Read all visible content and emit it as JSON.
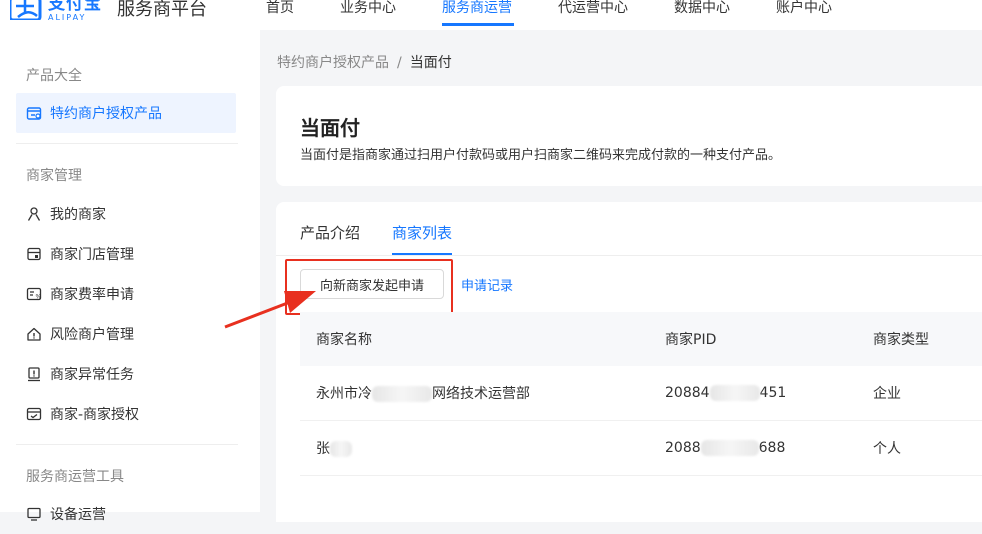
{
  "header": {
    "logo_cn": "支付宝",
    "logo_en": "ALIPAY",
    "platform": "服务商平台",
    "nav": [
      {
        "label": "首页"
      },
      {
        "label": "业务中心"
      },
      {
        "label": "服务商运营"
      },
      {
        "label": "代运营中心"
      },
      {
        "label": "数据中心"
      },
      {
        "label": "账户中心"
      }
    ],
    "active_nav": "服务商运营"
  },
  "sidebar": {
    "groups": [
      {
        "label": "产品大全"
      },
      {
        "label": "商家管理"
      },
      {
        "label": "服务商运营工具"
      }
    ],
    "items": [
      {
        "label": "特约商户授权产品",
        "icon": "shop-auth-icon",
        "active": true
      },
      {
        "label": "我的商家",
        "icon": "user-icon"
      },
      {
        "label": "商家门店管理",
        "icon": "store-icon"
      },
      {
        "label": "商家费率申请",
        "icon": "rate-icon"
      },
      {
        "label": "风险商户管理",
        "icon": "home-risk-icon"
      },
      {
        "label": "商家异常任务",
        "icon": "alert-icon"
      },
      {
        "label": "商家-商家授权",
        "icon": "auth-icon"
      },
      {
        "label": "设备运营",
        "icon": "device-icon"
      }
    ]
  },
  "breadcrumb": {
    "parent": "特约商户授权产品",
    "separator": "/",
    "current": "当面付"
  },
  "product": {
    "title": "当面付",
    "description": "当面付是指商家通过扫用户付款码或用户扫商家二维码来完成付款的一种支付产品。"
  },
  "tabs": [
    {
      "label": "产品介绍"
    },
    {
      "label": "商家列表"
    }
  ],
  "active_tab": "商家列表",
  "actions": {
    "apply_button": "向新商家发起申请",
    "record_link": "申请记录"
  },
  "table": {
    "columns": [
      "商家名称",
      "商家PID",
      "商家类型"
    ],
    "rows": [
      {
        "name_start": "永州市冷",
        "name_end": "网络技术运营部",
        "pid_start": "20884",
        "pid_end": "451",
        "type": "企业"
      },
      {
        "name_start": "张",
        "name_end": "",
        "pid_start": "2088",
        "pid_end": "688",
        "type": "个人"
      }
    ]
  },
  "colors": {
    "brand": "#1677ff",
    "highlight": "#e8301f"
  }
}
